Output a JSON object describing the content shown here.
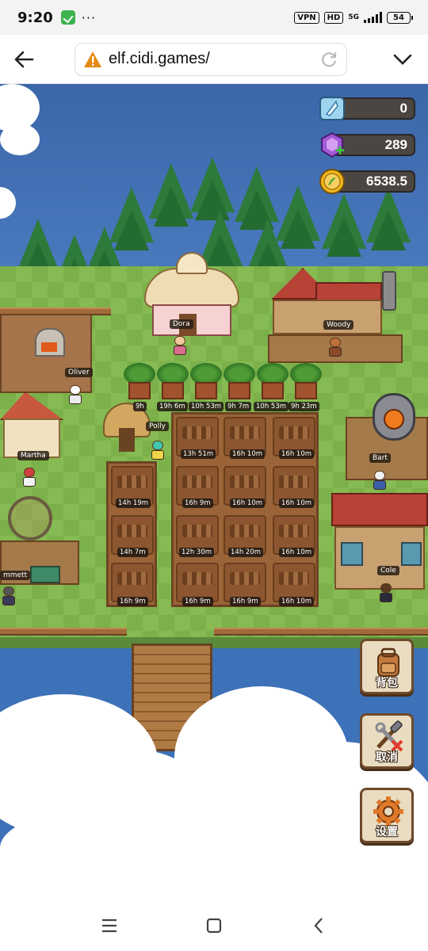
{
  "status": {
    "time": "9:20",
    "dots": "···",
    "vpn_label": "VPN",
    "hd_label": "HD",
    "network_label": "5G",
    "battery": "54"
  },
  "browser": {
    "url": "elf.cidi.games/"
  },
  "resources": {
    "crystal": "0",
    "gem": "289",
    "coin": "6538.5"
  },
  "npcs": {
    "dora": "Dora",
    "woody": "Woody",
    "oliver": "Oliver",
    "polly": "Polly",
    "martha": "Martha",
    "bart": "Bart",
    "emmett": "mmett",
    "cole": "Cole"
  },
  "timers": {
    "palm_row": [
      "9h",
      "19h 6m",
      "10h 53m",
      "9h 7m",
      "10h 53m",
      "9h 23m"
    ],
    "row1": [
      "13h 51m",
      "16h 10m",
      "16h 10m"
    ],
    "row2": [
      "14h 19m",
      "16h 9m",
      "16h 10m",
      "16h 10m"
    ],
    "row3": [
      "14h 7m",
      "12h 30m",
      "14h 20m",
      "16h 10m"
    ],
    "row4": [
      "16h 9m",
      "16h 9m",
      "16h 9m",
      "16h 10m"
    ]
  },
  "side_buttons": {
    "bag": "背包",
    "cancel": "取消",
    "settings": "设置"
  },
  "colors": {
    "grass": "#7cb04a",
    "soil": "#8b5630",
    "water": "#3d71b8",
    "sky": "#3b67aa",
    "resource_bar": "#4b4642",
    "button_bg": "#e9dcc0"
  },
  "icons": {
    "crystal": "crystal-icon",
    "gem": "gem-icon",
    "coin": "coin-icon",
    "bag": "backpack-icon",
    "cancel": "hammer-wrench-icon",
    "settings": "gear-icon"
  }
}
